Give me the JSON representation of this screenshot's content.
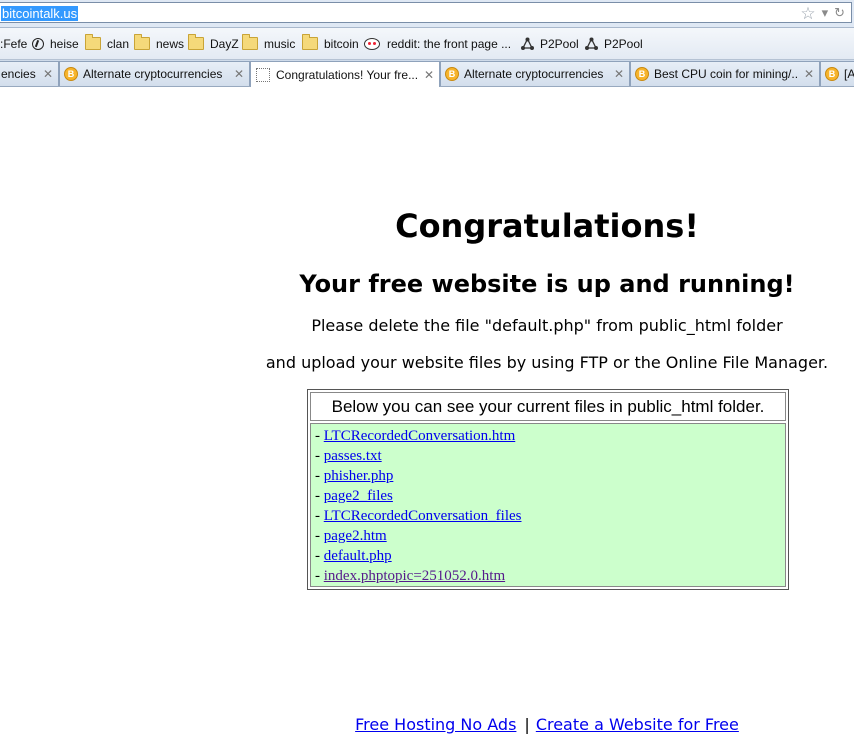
{
  "browser": {
    "url": "bitcointalk.us",
    "bookmarks": [
      {
        "label": ":Fefe",
        "icon": "none"
      },
      {
        "label": "heise",
        "icon": "heise-icon"
      },
      {
        "label": "clan",
        "icon": "folder-icon"
      },
      {
        "label": "news",
        "icon": "folder-icon"
      },
      {
        "label": "DayZ",
        "icon": "folder-icon"
      },
      {
        "label": "music",
        "icon": "folder-icon"
      },
      {
        "label": "bitcoin",
        "icon": "folder-icon"
      },
      {
        "label": "reddit: the front page ...",
        "icon": "reddit-icon"
      },
      {
        "label": "P2Pool",
        "icon": "p2pool-icon"
      },
      {
        "label": "P2Pool",
        "icon": "p2pool-icon"
      }
    ],
    "tabs": [
      {
        "label": "encies",
        "icon": "none",
        "active": false
      },
      {
        "label": "Alternate cryptocurrencies",
        "icon": "bitcoin-icon",
        "active": false
      },
      {
        "label": "Congratulations! Your fre...",
        "icon": "page-icon",
        "active": true
      },
      {
        "label": "Alternate cryptocurrencies",
        "icon": "bitcoin-icon",
        "active": false
      },
      {
        "label": "Best CPU coin for mining/...",
        "icon": "bitcoin-icon",
        "active": false
      },
      {
        "label": "[A",
        "icon": "bitcoin-icon",
        "active": false
      }
    ],
    "close_glyph": "✕"
  },
  "page": {
    "heading": "Congratulations!",
    "subheading": "Your free website is up and running!",
    "line1": "Please delete the file \"default.php\" from public_html folder",
    "line2": "and upload your website files by using FTP or the Online File Manager.",
    "files_header": "Below you can see your current files in public_html folder.",
    "files": [
      {
        "name": "LTCRecordedConversation.htm",
        "visited": false
      },
      {
        "name": "passes.txt",
        "visited": false
      },
      {
        "name": "phisher.php",
        "visited": false
      },
      {
        "name": "page2_files",
        "visited": false
      },
      {
        "name": "LTCRecordedConversation_files",
        "visited": false
      },
      {
        "name": "page2.htm",
        "visited": false
      },
      {
        "name": "default.php",
        "visited": false
      },
      {
        "name": "index.phptopic=251052.0.htm",
        "visited": true
      }
    ],
    "file_prefix": "- ",
    "footer": {
      "link1": "Free Hosting No Ads",
      "separator": "|",
      "link2": "Create a Website for Free"
    }
  }
}
